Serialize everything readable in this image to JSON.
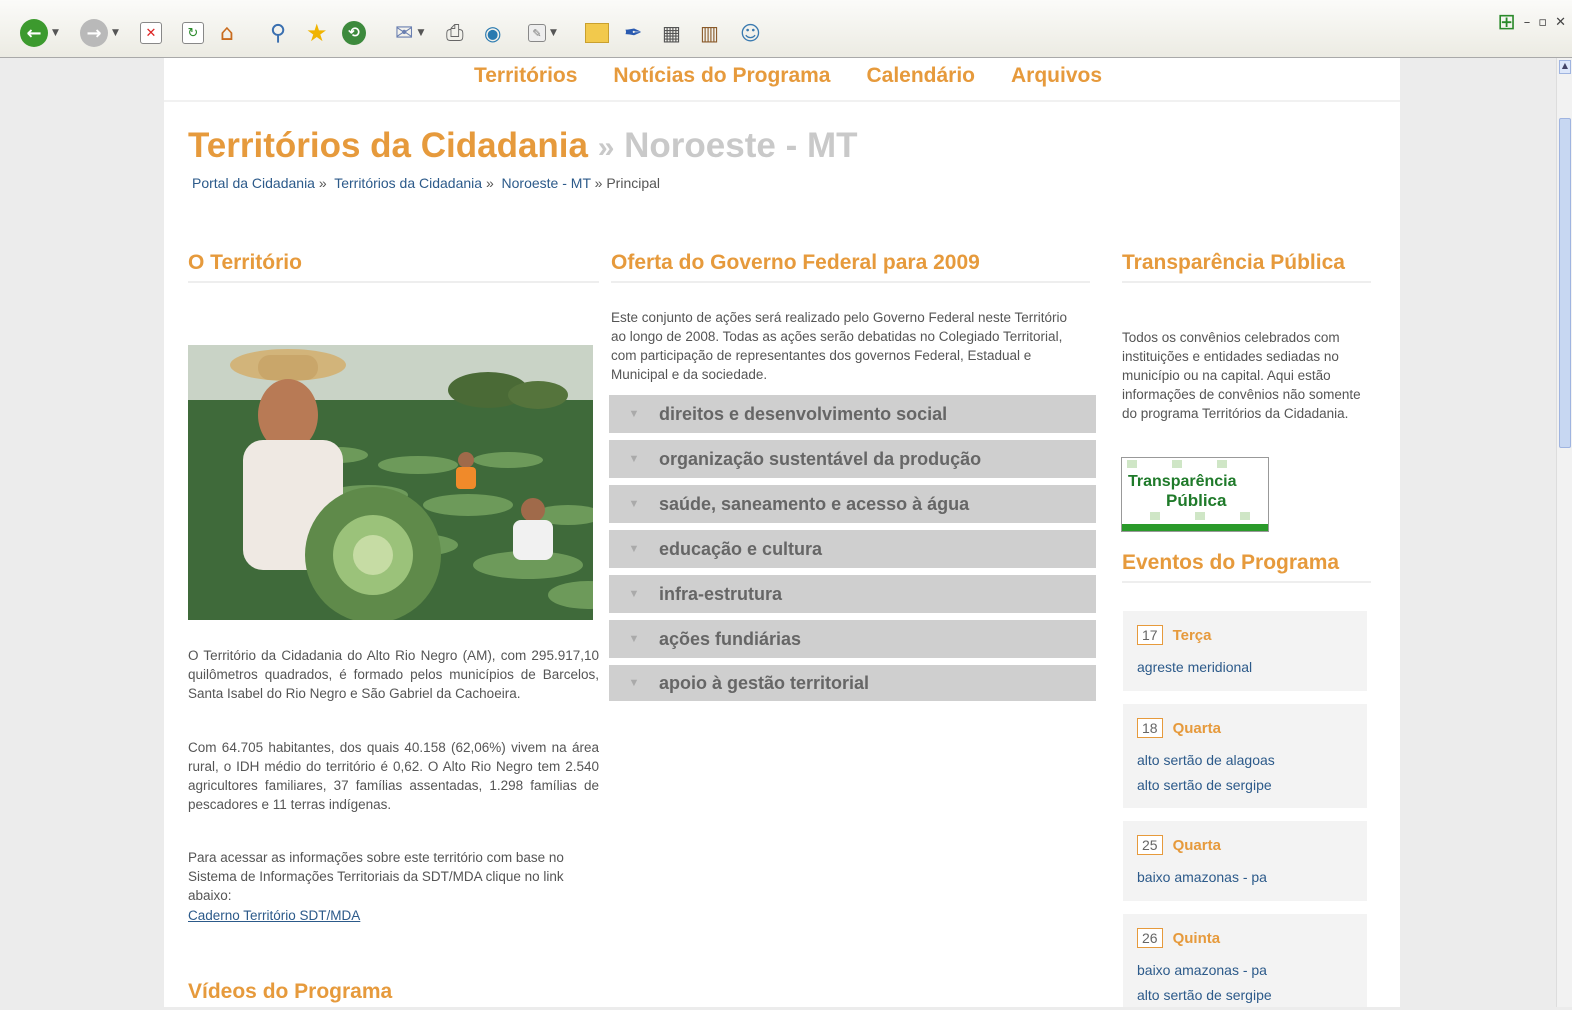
{
  "browser": {
    "toolbar_icons": [
      "back-icon",
      "forward-icon",
      "stop-icon",
      "refresh-icon",
      "home-icon",
      "search-icon",
      "favorites-star-icon",
      "history-icon",
      "mail-icon",
      "print-icon",
      "messenger-icon",
      "edit-icon",
      "folder-icon",
      "pen-icon",
      "research-icon",
      "books-icon",
      "users-icon"
    ]
  },
  "nav": {
    "items": [
      "Territórios",
      "Notícias do Programa",
      "Calendário",
      "Arquivos"
    ]
  },
  "header": {
    "title_main": "Territórios da Cidadania",
    "title_sep": "»",
    "title_sub": "Noroeste - MT",
    "breadcrumb": {
      "link1": "Portal da Cidadania",
      "link2": "Territórios da Cidadania",
      "link3": "Noroeste - MT",
      "current": "Principal",
      "sep": "»"
    }
  },
  "territorio": {
    "heading": "O Território",
    "p1": "O Território da Cidadania do Alto Rio Negro (AM), com 295.917,10 quilômetros quadrados, é formado pelos municípios de Barcelos, Santa Isabel do Rio Negro e São Gabriel da Cachoeira.",
    "p2": "Com 64.705 habitantes, dos quais 40.158 (62,06%) vivem na área rural, o IDH médio do território é 0,62. O Alto Rio Negro tem 2.540 agricultores familiares, 37 famílias assentadas, 1.298 famílias de pescadores e 11 terras indígenas.",
    "p3": "Para acessar as informações sobre este território com base no Sistema de Informações Territoriais da SDT/MDA clique no link abaixo:",
    "link": "Caderno Território SDT/MDA",
    "videos_heading": "Vídeos do Programa"
  },
  "oferta": {
    "heading": "Oferta do Governo Federal para 2009",
    "intro": "Este conjunto de ações será realizado pelo Governo Federal neste Território ao longo de 2008. Todas as ações serão debatidas no Colegiado Territorial, com participação de representantes dos governos Federal, Estadual e Municipal e da sociedade.",
    "items": [
      "direitos e desenvolvimento social",
      "organização sustentável da produção",
      "saúde, saneamento e acesso à água",
      "educação e cultura",
      "infra-estrutura",
      "ações fundiárias",
      "apoio à gestão territorial"
    ]
  },
  "transparencia": {
    "heading": "Transparência Pública",
    "text": "Todos os convênios celebrados com instituições e entidades sediadas no município ou na capital. Aqui estão informações de convênios não somente do programa Territórios da Cidadania.",
    "logo_line1": "Transparência",
    "logo_line2": "Pública"
  },
  "eventos": {
    "heading": "Eventos do Programa",
    "items": [
      {
        "num": "17",
        "day": "Terça",
        "links": [
          "agreste meridional"
        ]
      },
      {
        "num": "18",
        "day": "Quarta",
        "links": [
          "alto sertão de alagoas",
          "alto sertão de sergipe"
        ]
      },
      {
        "num": "25",
        "day": "Quarta",
        "links": [
          "baixo amazonas - pa"
        ]
      },
      {
        "num": "26",
        "day": "Quinta",
        "links": [
          "baixo amazonas - pa",
          "alto sertão de sergipe"
        ]
      }
    ]
  },
  "colors": {
    "accent": "#e69a3c",
    "link": "#2c5a8a",
    "muted": "#c9c9c9",
    "accordion": "#cfcfcf"
  }
}
